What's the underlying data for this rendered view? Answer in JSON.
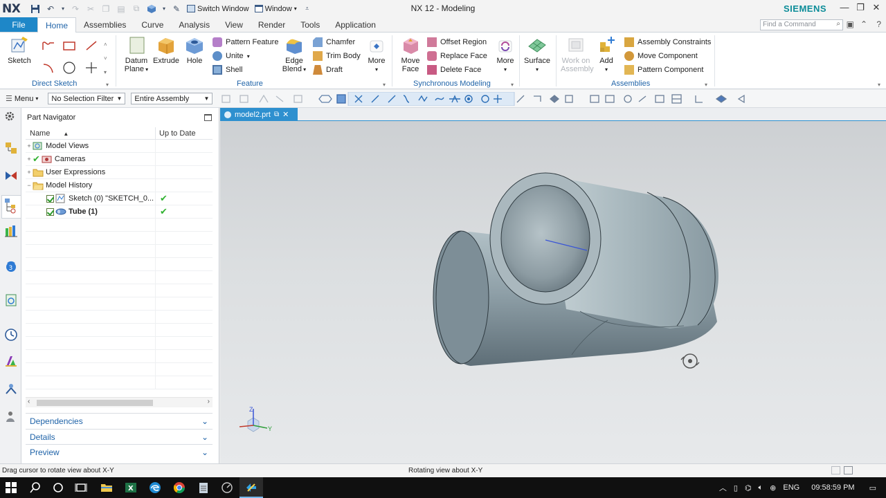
{
  "titlebar": {
    "logo": "NX",
    "switch_window": "Switch Window",
    "window_menu": "Window",
    "title": "NX 12 - Modeling",
    "brand": "SIEMENS"
  },
  "tabs": [
    "File",
    "Home",
    "Assemblies",
    "Curve",
    "Analysis",
    "View",
    "Render",
    "Tools",
    "Application"
  ],
  "active_tab": "Home",
  "find_command": {
    "placeholder": "Find a Command"
  },
  "ribbon": {
    "direct_sketch": {
      "label": "Direct Sketch",
      "sketch": "Sketch"
    },
    "feature": {
      "label": "Feature",
      "datum_plane_1": "Datum",
      "datum_plane_2": "Plane",
      "extrude": "Extrude",
      "hole": "Hole",
      "pattern_feature": "Pattern Feature",
      "unite": "Unite",
      "shell": "Shell",
      "edge_blend_1": "Edge",
      "edge_blend_2": "Blend",
      "chamfer": "Chamfer",
      "trim_body": "Trim Body",
      "draft": "Draft",
      "more": "More"
    },
    "synchronous": {
      "label": "Synchronous Modeling",
      "move_face_1": "Move",
      "move_face_2": "Face",
      "offset_region": "Offset Region",
      "replace_face": "Replace Face",
      "delete_face": "Delete Face",
      "more": "More"
    },
    "surface": {
      "label": "Surface"
    },
    "assemblies": {
      "label": "Assemblies",
      "work_on_1": "Work on",
      "work_on_2": "Assembly",
      "add": "Add",
      "assembly_constraints": "Assembly Constraints",
      "move_component": "Move Component",
      "pattern_component": "Pattern Component"
    }
  },
  "toolbar2": {
    "menu": "Menu",
    "selection_filter": "No Selection Filter",
    "scope": "Entire Assembly"
  },
  "navigator": {
    "title": "Part Navigator",
    "col_name": "Name",
    "col_uptodate": "Up to Date",
    "rows": [
      {
        "label": "Model Views"
      },
      {
        "label": "Cameras"
      },
      {
        "label": "User Expressions"
      },
      {
        "label": "Model History"
      },
      {
        "label": "Sketch (0) \"SKETCH_0..."
      },
      {
        "label": "Tube (1)"
      }
    ],
    "panels": [
      "Dependencies",
      "Details",
      "Preview"
    ]
  },
  "doc_tab": {
    "label": "model2.prt"
  },
  "triad": {
    "z": "Z",
    "y": "Y"
  },
  "status": {
    "left": "Drag cursor to rotate view about X-Y",
    "center": "Rotating view about X-Y"
  },
  "taskbar": {
    "lang": "ENG",
    "time": "09:58:59 PM"
  },
  "colors": {
    "accent": "#1e87c8",
    "brand": "#0b8c98",
    "tab_active_text": "#1f63a8",
    "model_body": "#8a9ba6"
  }
}
